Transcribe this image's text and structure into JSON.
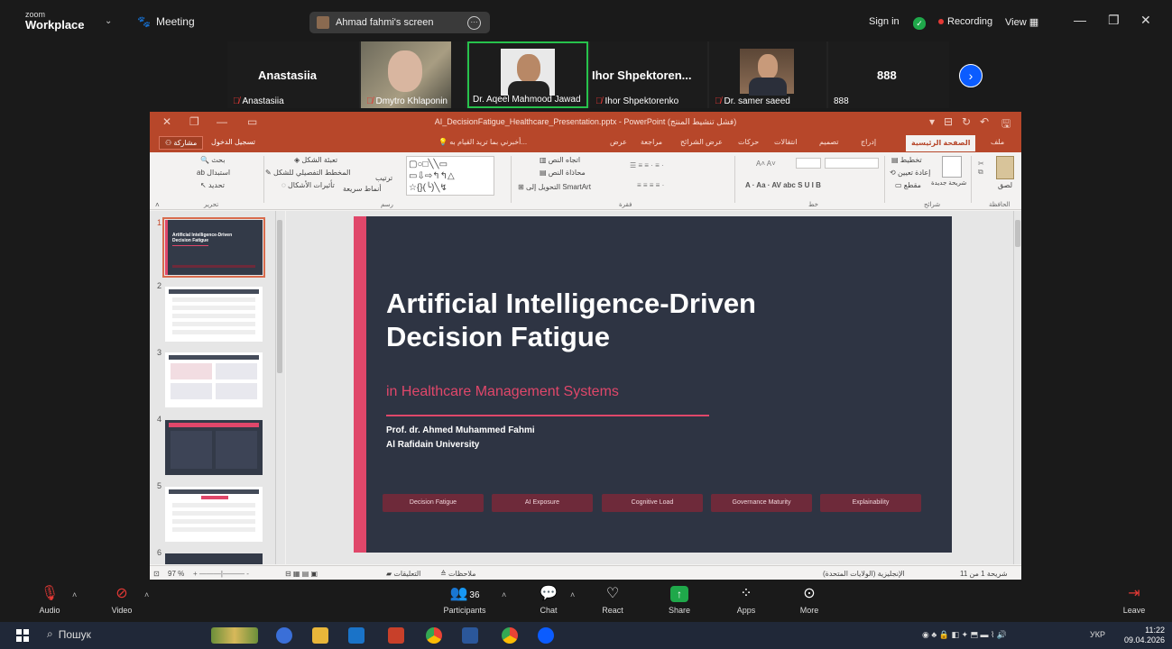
{
  "zoom": {
    "brand_top": "zoom",
    "brand_bottom": "Workplace",
    "meeting_label": "Meeting",
    "share_pill": "Ahmad fahmi's screen",
    "sign_in": "Sign in",
    "recording": "Recording",
    "view": "View",
    "participants_count": "36"
  },
  "gallery": [
    {
      "name_big": "Anastasiia",
      "label": "Anastasiia"
    },
    {
      "label": "Dmytro Khlaponin"
    },
    {
      "label": "Dr. Aqeel Mahmood Jawad"
    },
    {
      "name_big": "Ihor Shpektoren...",
      "label": "Ihor Shpektorenko"
    },
    {
      "label": "Dr. samer saeed"
    },
    {
      "name_big": "888",
      "label": "888"
    }
  ],
  "ppt": {
    "title": "AI_DecisionFatigue_Healthcare_Presentation.pptx - PowerPoint (فشل تنشيط المنتج)",
    "share_btn": "مشاركة",
    "login": "تسجيل الدخول",
    "tell_me": "أخبرني بما تريد القيام به...",
    "tabs": [
      "ملف",
      "الصفحة الرئيسية",
      "إدراج",
      "تصميم",
      "انتقالات",
      "حركات",
      "عرض الشرائح",
      "مراجعة",
      "عرض"
    ],
    "ribbon": {
      "clipboard": "الحافظة",
      "slides": "شرائح",
      "font": "خط",
      "paragraph": "فقرة",
      "drawing": "رسم",
      "editing": "تحرير",
      "paste": "لصق",
      "new_slide": "شريحة جديدة",
      "layout": "تخطيط",
      "reset": "إعادة تعيين",
      "section": "مقطع",
      "text_dir": "اتجاه النص",
      "align_text": "محاذاة النص",
      "smartart": "التحويل إلى SmartArt",
      "shape_fill": "تعبئة الشكل",
      "shape_outline": "المخطط التفصيلي للشكل",
      "shape_effects": "تأثيرات الأشكال",
      "arrange": "ترتيب",
      "quick_styles": "أنماط سريعة",
      "find": "بحث",
      "replace": "استبدال",
      "select": "تحديد"
    },
    "slide": {
      "title_line1": "Artificial Intelligence-Driven",
      "title_line2": "Decision Fatigue",
      "subtitle": "in Healthcare Management Systems",
      "author": "Prof. dr. Ahmed Muhammed Fahmi",
      "university": "Al Rafidain University",
      "tags": [
        "Decision Fatigue",
        "AI Exposure",
        "Cognitive Load",
        "Governance Maturity",
        "Explainability"
      ]
    },
    "thumb1_title": "Artificial Intelligence-Driven Decision Fatigue",
    "slide_numbers": [
      "1",
      "2",
      "3",
      "4",
      "5",
      "6"
    ],
    "status": {
      "slide_of": "شريحة 1 من 11",
      "language": "الإنجليزية (الولايات المتحدة)",
      "notes": "ملاحظات",
      "comments": "التعليقات",
      "zoom": "97 %"
    }
  },
  "toolbar": {
    "audio": "Audio",
    "video": "Video",
    "participants": "Participants",
    "chat": "Chat",
    "react": "React",
    "share": "Share",
    "apps": "Apps",
    "more": "More",
    "leave": "Leave"
  },
  "taskbar": {
    "search": "Пошук",
    "lang": "УКР",
    "time": "11:22",
    "date": "09.04.2026"
  }
}
